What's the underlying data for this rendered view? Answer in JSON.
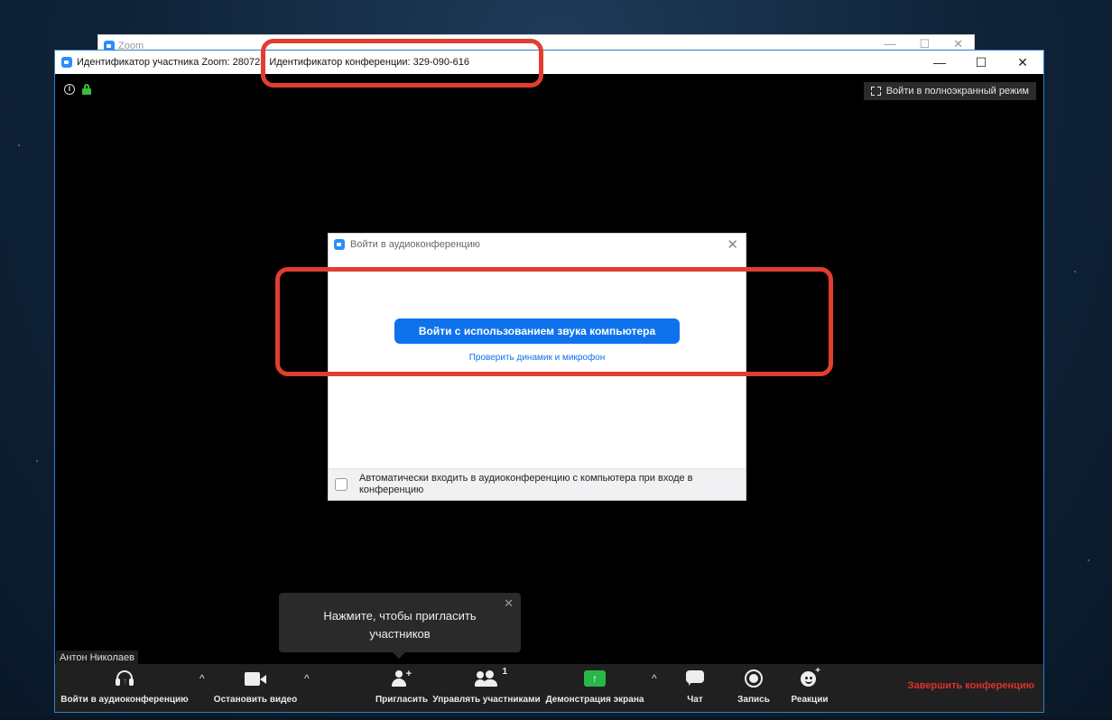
{
  "back_window": {
    "title": "Zoom",
    "controls": [
      "—",
      "☐",
      "✕"
    ]
  },
  "window": {
    "title_participant": "Идентификатор участника Zoom: 280723",
    "title_meeting": "Идентификатор конференции: 329-090-616",
    "controls": {
      "minimize": "—",
      "maximize": "☐",
      "close": "✕"
    }
  },
  "top_bar": {
    "info_icon": "i",
    "fullscreen_label": "Войти в полноэкранный режим"
  },
  "audio_dialog": {
    "title": "Войти в аудиоконференцию",
    "close": "✕",
    "join_button": "Войти с использованием звука компьютера",
    "test_link": "Проверить динамик и микрофон",
    "auto_join_label": "Автоматически входить в аудиоконференцию с компьютера при входе в конференцию"
  },
  "invite_tooltip": {
    "text": "Нажмите, чтобы пригласить участников",
    "close": "✕"
  },
  "participant_name": "Антон Николаев",
  "toolbar": {
    "join_audio": "Войти в аудиоконференцию",
    "stop_video": "Остановить видео",
    "invite": "Пригласить",
    "manage_participants": "Управлять участниками",
    "participants_count": "1",
    "share_screen": "Демонстрация экрана",
    "chat": "Чат",
    "record": "Запись",
    "reactions": "Реакции",
    "end_meeting": "Завершить конференцию",
    "caret": "^",
    "share_arrow": "↑"
  },
  "colors": {
    "accent_blue": "#0e72ed",
    "share_green": "#27b84a",
    "end_red": "#e0312b",
    "highlight_red": "#e23d31"
  }
}
